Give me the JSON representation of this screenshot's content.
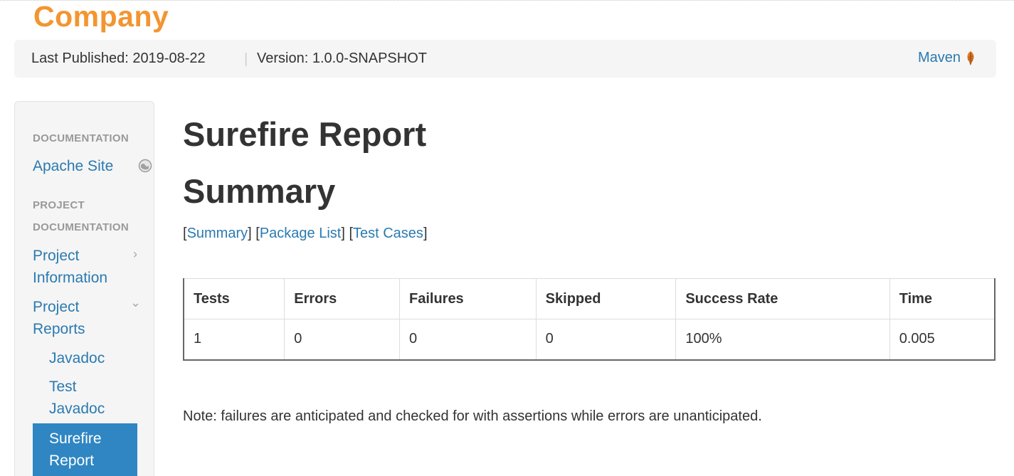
{
  "brand": {
    "name": "Company"
  },
  "breadcrumbs": {
    "published": "Last Published: 2019-08-22",
    "separator": "|",
    "version": "Version: 1.0.0-SNAPSHOT",
    "maven_link": "Maven"
  },
  "sidebar": {
    "header_documentation": "DOCUMENTATION",
    "apache_site": "Apache Site",
    "header_project_documentation_1": "PROJECT",
    "header_project_documentation_2": "DOCUMENTATION",
    "project_information_1": "Project",
    "project_information_2": "Information",
    "project_reports_1": "Project",
    "project_reports_2": "Reports",
    "javadoc": "Javadoc",
    "test_javadoc_1": "Test",
    "test_javadoc_2": "Javadoc",
    "surefire_report_1": "Surefire",
    "surefire_report_2": "Report",
    "chevron_right": "›",
    "chevron_down": "⌄"
  },
  "main": {
    "title": "Surefire Report",
    "subtitle": "Summary",
    "section_links": {
      "summary": "Summary",
      "package_list": "Package List",
      "test_cases": "Test Cases"
    },
    "table": {
      "headers": [
        "Tests",
        "Errors",
        "Failures",
        "Skipped",
        "Success Rate",
        "Time"
      ],
      "rows": [
        [
          "1",
          "0",
          "0",
          "0",
          "100%",
          "0.005"
        ]
      ]
    },
    "note": "Note: failures are anticipated and checked for with assertions while errors are unanticipated."
  },
  "colors": {
    "brand": "#f39530",
    "link": "#2a7ab0",
    "active_nav": "#2f86c3"
  },
  "icons": {
    "maven": "feather-icon",
    "apache_site": "globe-icon"
  }
}
